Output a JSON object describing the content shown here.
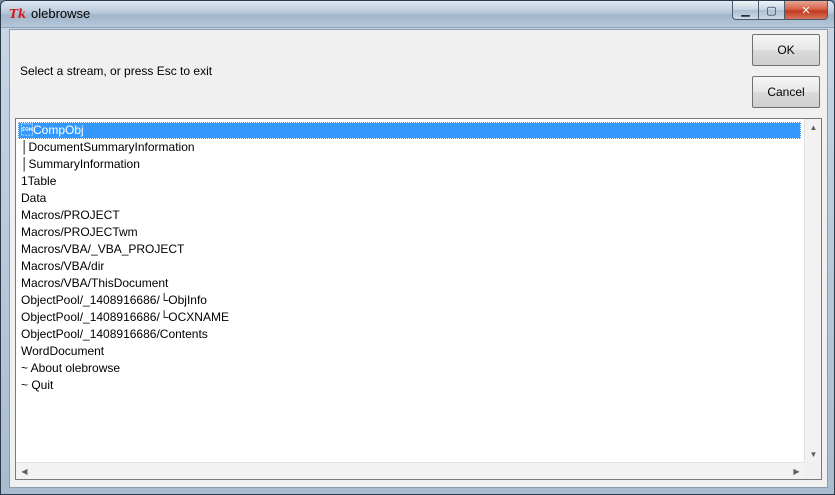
{
  "window": {
    "title": "olebrowse",
    "icon": "tk-feather-icon",
    "controls": {
      "minimize": "▁",
      "maximize": "▢",
      "close": "✕"
    }
  },
  "prompt": "Select a stream, or press Esc to exit",
  "buttons": {
    "ok": "OK",
    "cancel": "Cancel"
  },
  "list": {
    "selected_index": 0,
    "items": [
      "\u0001CompObj",
      "│DocumentSummaryInformation",
      "│SummaryInformation",
      "1Table",
      "Data",
      "Macros/PROJECT",
      "Macros/PROJECTwm",
      "Macros/VBA/_VBA_PROJECT",
      "Macros/VBA/dir",
      "Macros/VBA/ThisDocument",
      "ObjectPool/_1408916686/└ObjInfo",
      "ObjectPool/_1408916686/└OCXNAME",
      "ObjectPool/_1408916686/Contents",
      "WordDocument",
      "~ About olebrowse",
      "~ Quit"
    ]
  },
  "scrollbars": {
    "up": "▲",
    "down": "▼",
    "left": "◀",
    "right": "▶"
  },
  "colors": {
    "selection": "#3399ff",
    "title_bar": "#b7c8da",
    "close_button": "#c0391f"
  }
}
